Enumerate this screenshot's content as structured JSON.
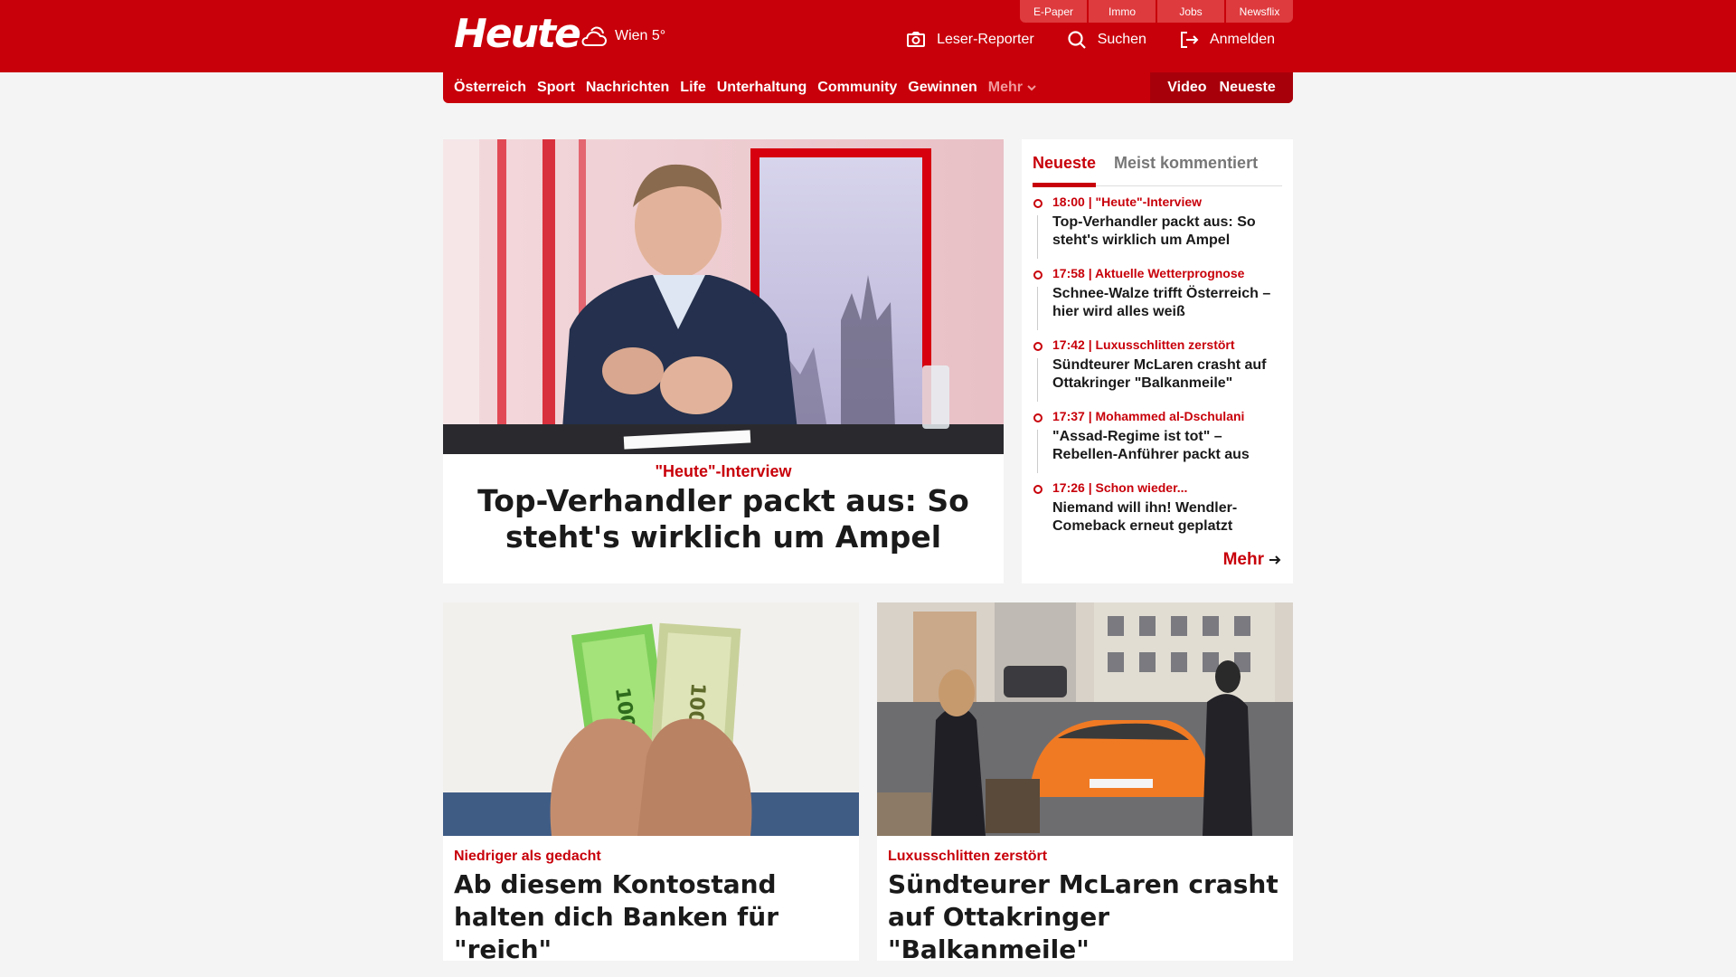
{
  "header": {
    "logo": "Heute",
    "weather": "Wien 5°",
    "top_links": [
      "E-Paper",
      "Immo",
      "Jobs",
      "Newsflix"
    ],
    "actions": [
      {
        "label": "Leser-Reporter",
        "icon": "camera-icon"
      },
      {
        "label": "Suchen",
        "icon": "search-icon"
      },
      {
        "label": "Anmelden",
        "icon": "login-icon"
      }
    ]
  },
  "nav": {
    "items": [
      "Österreich",
      "Sport",
      "Nachrichten",
      "Life",
      "Unterhaltung",
      "Community",
      "Gewinnen"
    ],
    "more": "Mehr",
    "right": [
      "Video",
      "Neueste"
    ]
  },
  "hero": {
    "kicker": "\"Heute\"-Interview",
    "title": "Top-Verhandler packt aus: So steht's wirklich um Ampel"
  },
  "sidebar": {
    "tabs": [
      "Neueste",
      "Meist kommentiert"
    ],
    "items": [
      {
        "meta": "18:00 | \"Heute\"-Interview",
        "title": "Top-Verhandler packt aus: So steht's wirklich um Ampel"
      },
      {
        "meta": "17:58 | Aktuelle Wetterprognose",
        "title": "Schnee-Walze trifft Österreich – hier wird alles weiß"
      },
      {
        "meta": "17:42 | Luxusschlitten zerstört",
        "title": "Sündteurer McLaren crasht auf Ottakringer \"Balkanmeile\""
      },
      {
        "meta": "17:37 | Mohammed al-Dschulani",
        "title": "\"Assad-Regime ist tot\" – Rebellen-Anführer packt aus"
      },
      {
        "meta": "17:26 | Schon wieder...",
        "title": "Niemand will ihn! Wendler-Comeback erneut geplatzt"
      }
    ],
    "more": "Mehr"
  },
  "cards": [
    {
      "kicker": "Niedriger als gedacht",
      "title": "Ab diesem Kontostand halten dich Banken für \"reich\""
    },
    {
      "kicker": "Luxusschlitten zerstört",
      "title": "Sündteurer McLaren crasht auf Ottakringer \"Balkanmeile\""
    }
  ],
  "colors": {
    "brand": "#c8000a",
    "brand_dark": "#a8000a",
    "page_bg": "#f4f4f4"
  }
}
